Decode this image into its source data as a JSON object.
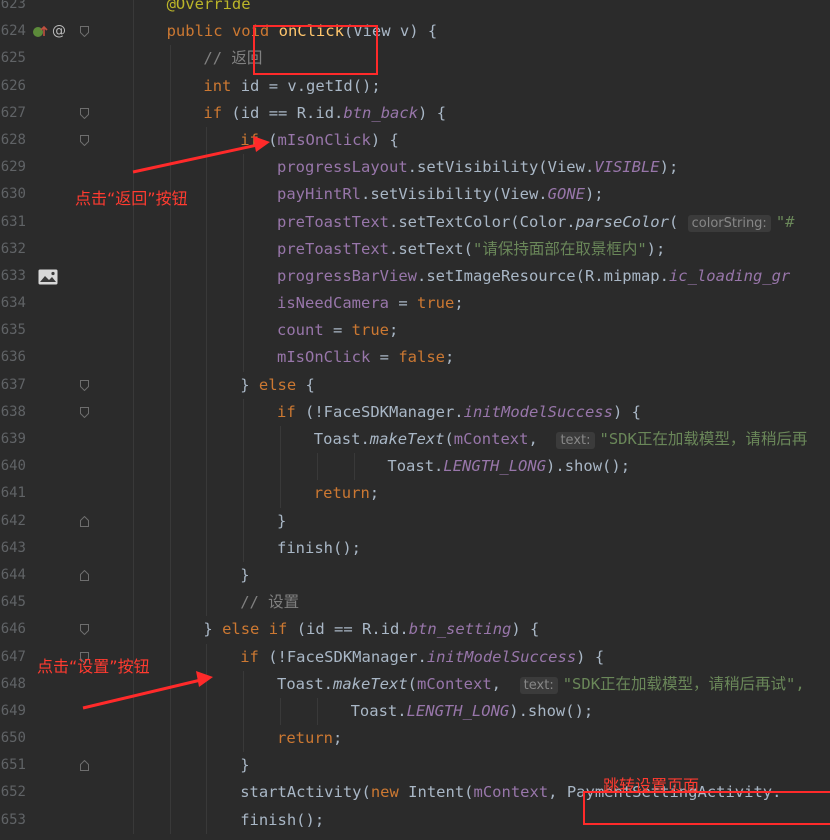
{
  "editor": {
    "lines": [
      {
        "num": "623",
        "indent": 2,
        "fold": "none",
        "tokens": [
          {
            "t": "@Override",
            "c": "annotation"
          }
        ]
      },
      {
        "num": "624",
        "indent": 2,
        "fold": "open",
        "gutter": "override",
        "tokens": [
          {
            "t": "public",
            "c": "keyword"
          },
          {
            "t": " "
          },
          {
            "t": "void",
            "c": "keyword"
          },
          {
            "t": " "
          },
          {
            "t": "onClick",
            "c": "method"
          },
          {
            "t": "(View v) {"
          }
        ]
      },
      {
        "num": "625",
        "indent": 3,
        "fold": "none",
        "tokens": [
          {
            "t": "// 返回",
            "c": "comment"
          }
        ]
      },
      {
        "num": "626",
        "indent": 3,
        "fold": "none",
        "tokens": [
          {
            "t": "int",
            "c": "keyword"
          },
          {
            "t": " id = v.getId();"
          }
        ]
      },
      {
        "num": "627",
        "indent": 3,
        "fold": "open",
        "tokens": [
          {
            "t": "if",
            "c": "keyword"
          },
          {
            "t": " (id == R.id."
          },
          {
            "t": "btn_back",
            "c": "staticf"
          },
          {
            "t": ") {"
          }
        ]
      },
      {
        "num": "628",
        "indent": 4,
        "fold": "open",
        "tokens": [
          {
            "t": "if",
            "c": "keyword"
          },
          {
            "t": " ("
          },
          {
            "t": "mIsOnClick",
            "c": "field"
          },
          {
            "t": ") {"
          }
        ]
      },
      {
        "num": "629",
        "indent": 5,
        "fold": "none",
        "tokens": [
          {
            "t": "progressLayout",
            "c": "field"
          },
          {
            "t": ".setVisibility(View."
          },
          {
            "t": "VISIBLE",
            "c": "staticf"
          },
          {
            "t": ");"
          }
        ]
      },
      {
        "num": "630",
        "indent": 5,
        "fold": "none",
        "tokens": [
          {
            "t": "payHintRl",
            "c": "field"
          },
          {
            "t": ".setVisibility(View."
          },
          {
            "t": "GONE",
            "c": "staticf"
          },
          {
            "t": ");"
          }
        ]
      },
      {
        "num": "631",
        "indent": 5,
        "fold": "none",
        "tokens": [
          {
            "t": "preToastText",
            "c": "field"
          },
          {
            "t": ".setTextColor(Color."
          },
          {
            "t": "parseColor",
            "c": "staticm"
          },
          {
            "t": "( "
          },
          {
            "t": "colorString:",
            "c": "hint"
          },
          {
            "t": "\"#",
            "c": "string"
          }
        ]
      },
      {
        "num": "632",
        "indent": 5,
        "fold": "none",
        "tokens": [
          {
            "t": "preToastText",
            "c": "field"
          },
          {
            "t": ".setText("
          },
          {
            "t": "\"请保持面部在取景框内\"",
            "c": "string"
          },
          {
            "t": ");"
          }
        ]
      },
      {
        "num": "633",
        "indent": 5,
        "fold": "none",
        "gutter": "image",
        "tokens": [
          {
            "t": "progressBarView",
            "c": "field"
          },
          {
            "t": ".setImageResource(R.mipmap."
          },
          {
            "t": "ic_loading_gr",
            "c": "staticf"
          }
        ]
      },
      {
        "num": "634",
        "indent": 5,
        "fold": "none",
        "tokens": [
          {
            "t": "isNeedCamera",
            "c": "field"
          },
          {
            "t": " = "
          },
          {
            "t": "true",
            "c": "keyword"
          },
          {
            "t": ";"
          }
        ]
      },
      {
        "num": "635",
        "indent": 5,
        "fold": "none",
        "tokens": [
          {
            "t": "count",
            "c": "field"
          },
          {
            "t": " = "
          },
          {
            "t": "true",
            "c": "keyword"
          },
          {
            "t": ";"
          }
        ]
      },
      {
        "num": "636",
        "indent": 5,
        "fold": "none",
        "tokens": [
          {
            "t": "mIsOnClick",
            "c": "field"
          },
          {
            "t": " = "
          },
          {
            "t": "false",
            "c": "keyword"
          },
          {
            "t": ";"
          }
        ]
      },
      {
        "num": "637",
        "indent": 4,
        "fold": "open",
        "tokens": [
          {
            "t": "} "
          },
          {
            "t": "else",
            "c": "keyword"
          },
          {
            "t": " {"
          }
        ]
      },
      {
        "num": "638",
        "indent": 5,
        "fold": "open",
        "tokens": [
          {
            "t": "if",
            "c": "keyword"
          },
          {
            "t": " (!FaceSDKManager."
          },
          {
            "t": "initModelSuccess",
            "c": "staticf"
          },
          {
            "t": ") {"
          }
        ]
      },
      {
        "num": "639",
        "indent": 6,
        "fold": "none",
        "tokens": [
          {
            "t": "Toast."
          },
          {
            "t": "makeText",
            "c": "staticm"
          },
          {
            "t": "("
          },
          {
            "t": "mContext",
            "c": "field"
          },
          {
            "t": ",  "
          },
          {
            "t": "text:",
            "c": "hint"
          },
          {
            "t": "\"SDK正在加载模型，请稍后再",
            "c": "string"
          }
        ]
      },
      {
        "num": "640",
        "indent": 8,
        "fold": "none",
        "tokens": [
          {
            "t": "Toast."
          },
          {
            "t": "LENGTH_LONG",
            "c": "staticf"
          },
          {
            "t": ").show();"
          }
        ]
      },
      {
        "num": "641",
        "indent": 6,
        "fold": "none",
        "tokens": [
          {
            "t": "return",
            "c": "keyword"
          },
          {
            "t": ";"
          }
        ]
      },
      {
        "num": "642",
        "indent": 5,
        "fold": "close",
        "tokens": [
          {
            "t": "}"
          }
        ]
      },
      {
        "num": "643",
        "indent": 5,
        "fold": "none",
        "tokens": [
          {
            "t": "finish();"
          }
        ]
      },
      {
        "num": "644",
        "indent": 4,
        "fold": "close",
        "tokens": [
          {
            "t": "}"
          }
        ]
      },
      {
        "num": "645",
        "indent": 4,
        "fold": "none",
        "tokens": [
          {
            "t": "// 设置",
            "c": "comment"
          }
        ]
      },
      {
        "num": "646",
        "indent": 3,
        "fold": "open",
        "tokens": [
          {
            "t": "} "
          },
          {
            "t": "else if",
            "c": "keyword"
          },
          {
            "t": " (id == R.id."
          },
          {
            "t": "btn_setting",
            "c": "staticf"
          },
          {
            "t": ") {"
          }
        ]
      },
      {
        "num": "647",
        "indent": 4,
        "fold": "open",
        "tokens": [
          {
            "t": "if",
            "c": "keyword"
          },
          {
            "t": " (!FaceSDKManager."
          },
          {
            "t": "initModelSuccess",
            "c": "staticf"
          },
          {
            "t": ") {"
          }
        ]
      },
      {
        "num": "648",
        "indent": 5,
        "fold": "none",
        "tokens": [
          {
            "t": "Toast."
          },
          {
            "t": "makeText",
            "c": "staticm"
          },
          {
            "t": "("
          },
          {
            "t": "mContext",
            "c": "field"
          },
          {
            "t": ",  "
          },
          {
            "t": "text:",
            "c": "hint"
          },
          {
            "t": "\"SDK正在加载模型，请稍后再试\",",
            "c": "string"
          }
        ]
      },
      {
        "num": "649",
        "indent": 7,
        "fold": "none",
        "tokens": [
          {
            "t": "Toast."
          },
          {
            "t": "LENGTH_LONG",
            "c": "staticf"
          },
          {
            "t": ").show();"
          }
        ]
      },
      {
        "num": "650",
        "indent": 5,
        "fold": "none",
        "tokens": [
          {
            "t": "return",
            "c": "keyword"
          },
          {
            "t": ";"
          }
        ]
      },
      {
        "num": "651",
        "indent": 4,
        "fold": "close",
        "tokens": [
          {
            "t": "}"
          }
        ]
      },
      {
        "num": "652",
        "indent": 4,
        "fold": "none",
        "tokens": [
          {
            "t": "startActivity("
          },
          {
            "t": "new",
            "c": "keyword"
          },
          {
            "t": " Intent("
          },
          {
            "t": "mContext",
            "c": "field"
          },
          {
            "t": ", PaymentSettingActivity."
          }
        ]
      },
      {
        "num": "653",
        "indent": 4,
        "fold": "none",
        "tokens": [
          {
            "t": "finish();"
          }
        ]
      }
    ]
  },
  "annotations": {
    "back_label": "点击“返回”按钮",
    "setting_label": "点击“设置”按钮",
    "jump_label": "跳转设置页面",
    "color": "#ff2a2a"
  },
  "colors": {
    "background": "#2b2b2b",
    "keyword": "#cc7832",
    "method": "#ffc66d",
    "field": "#9876aa",
    "string": "#6a8759",
    "comment": "#808080",
    "annotation": "#bbb529",
    "default": "#a9b7c6"
  }
}
